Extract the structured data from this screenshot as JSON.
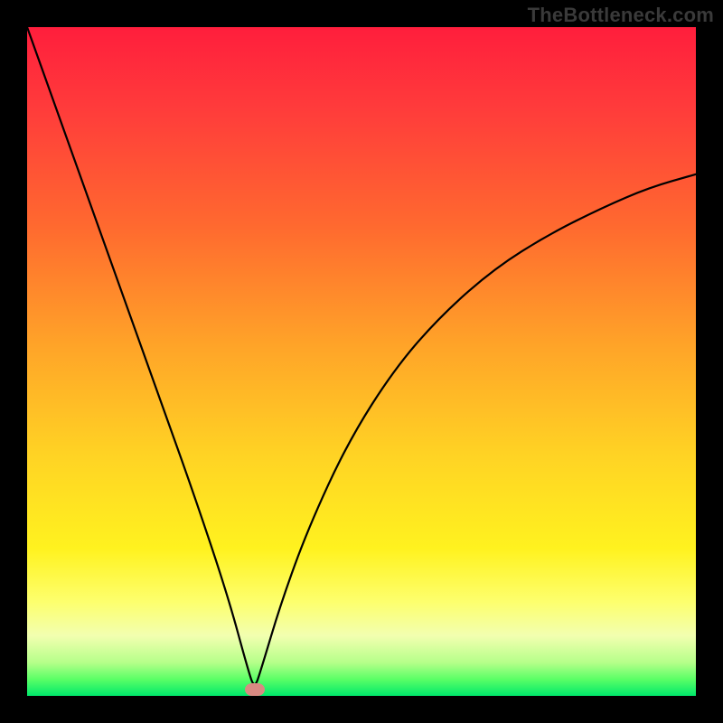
{
  "watermark": "TheBottleneck.com",
  "colors": {
    "frame": "#000000",
    "watermark_text": "#3a3a3a",
    "curve": "#000000",
    "marker": "#d98a82",
    "gradient_stops": [
      "#ff1e3c",
      "#ff3b3b",
      "#ff6a2f",
      "#ffa528",
      "#ffd324",
      "#fff21f",
      "#fdff6e",
      "#f2ffb0",
      "#b6ff8a",
      "#5bff66",
      "#00e86b"
    ]
  },
  "chart_data": {
    "type": "line",
    "title": "",
    "xlabel": "",
    "ylabel": "",
    "xlim": [
      0,
      100
    ],
    "ylim": [
      0,
      100
    ],
    "grid": false,
    "legend": false,
    "annotations": [
      "TheBottleneck.com"
    ],
    "marker": {
      "x": 34,
      "y": 1
    },
    "series": [
      {
        "name": "bottleneck-curve",
        "x": [
          0,
          5,
          10,
          15,
          20,
          25,
          30,
          33,
          34,
          35,
          38,
          42,
          48,
          55,
          62,
          70,
          78,
          86,
          93,
          100
        ],
        "values": [
          100,
          86,
          72,
          58,
          44,
          30,
          15,
          4,
          1,
          4,
          14,
          25,
          38,
          49,
          57,
          64,
          69,
          73,
          76,
          78
        ]
      }
    ]
  }
}
